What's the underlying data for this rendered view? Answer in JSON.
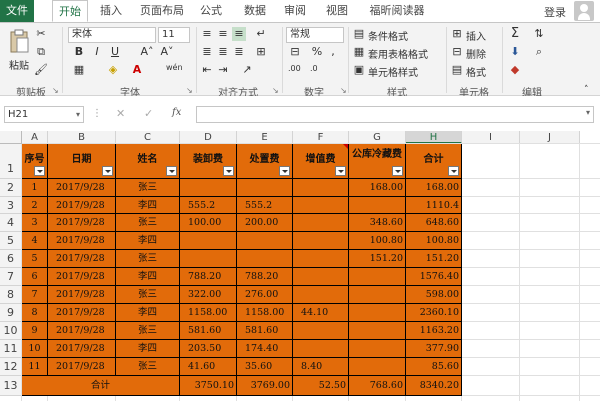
{
  "tabs": [
    "文件",
    "开始",
    "插入",
    "页面布局",
    "公式",
    "数据",
    "审阅",
    "视图",
    "福昕阅读器"
  ],
  "login": "登录",
  "ribbon": {
    "paste": "粘贴",
    "font_name": "宋体",
    "font_size": "11",
    "number_format": "常规",
    "conditional_format": "条件格式",
    "table_format": "套用表格格式",
    "cell_style": "单元格样式",
    "insert": "插入",
    "delete": "删除",
    "format": "格式",
    "wen": "wén",
    "groups": [
      "剪贴板",
      "字体",
      "对齐方式",
      "数字",
      "样式",
      "单元格",
      "编辑"
    ]
  },
  "formula_bar": {
    "name_box": "H21",
    "fx": "fx",
    "value": ""
  },
  "columns": [
    "A",
    "B",
    "C",
    "D",
    "E",
    "F",
    "G",
    "H",
    "I",
    "J"
  ],
  "selected_column": "H",
  "rows": [
    "1",
    "2",
    "3",
    "4",
    "5",
    "6",
    "7",
    "8",
    "9",
    "10",
    "11",
    "12",
    "13"
  ],
  "table": {
    "headers": [
      "序号",
      "日期",
      "姓名",
      "装卸费",
      "处置费",
      "增值费",
      "公库冷藏费",
      "合计"
    ],
    "rows": [
      [
        "1",
        "2017/9/28",
        "张三",
        "",
        "",
        "",
        "168.00",
        "168.00"
      ],
      [
        "2",
        "2017/9/28",
        "李四",
        "555.2",
        "555.2",
        "",
        "",
        "1110.4"
      ],
      [
        "3",
        "2017/9/28",
        "张三",
        "100.00",
        "200.00",
        "",
        "348.60",
        "648.60"
      ],
      [
        "4",
        "2017/9/28",
        "李四",
        "",
        "",
        "",
        "100.80",
        "100.80"
      ],
      [
        "5",
        "2017/9/28",
        "张三",
        "",
        "",
        "",
        "151.20",
        "151.20"
      ],
      [
        "6",
        "2017/9/28",
        "李四",
        "788.20",
        "788.20",
        "",
        "",
        "1576.40"
      ],
      [
        "7",
        "2017/9/28",
        "张三",
        "322.00",
        "276.00",
        "",
        "",
        "598.00"
      ],
      [
        "8",
        "2017/9/28",
        "李四",
        "1158.00",
        "1158.00",
        "44.10",
        "",
        "2360.10"
      ],
      [
        "9",
        "2017/9/28",
        "张三",
        "581.60",
        "581.60",
        "",
        "",
        "1163.20"
      ],
      [
        "10",
        "2017/9/28",
        "李四",
        "203.50",
        "174.40",
        "",
        "",
        "377.90"
      ],
      [
        "11",
        "2017/9/28",
        "张三",
        "41.60",
        "35.60",
        "8.40",
        "",
        "85.60"
      ]
    ],
    "total": {
      "label": "合计",
      "values": [
        "3750.10",
        "3769.00",
        "52.50",
        "768.60",
        "8340.20"
      ]
    }
  },
  "colors": {
    "accent": "#217346",
    "table_fill": "#e26b0a"
  }
}
